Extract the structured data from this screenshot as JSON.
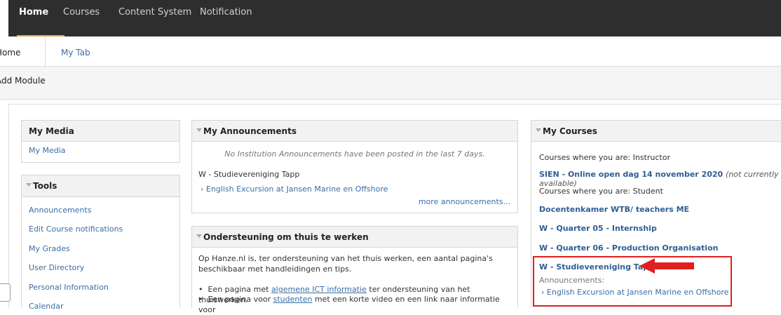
{
  "topnav": [
    {
      "label": "Home",
      "active": true
    },
    {
      "label": "Courses",
      "active": false
    },
    {
      "label": "Content System",
      "active": false
    },
    {
      "label": "Notification",
      "active": false
    }
  ],
  "tabs": {
    "home": "Home",
    "my_tab": "My Tab"
  },
  "add_module": "Add Module",
  "my_media": {
    "title": "My Media",
    "link": "My Media"
  },
  "tools": {
    "title": "Tools",
    "items": [
      "Announcements",
      "Edit Course notifications",
      "My Grades",
      "User Directory",
      "Personal Information",
      "Calendar"
    ]
  },
  "announcements": {
    "title": "My Announcements",
    "none_msg": "No Institution Announcements have been posted in the last 7 days.",
    "group": "W - Studievereniging Tapp",
    "item": "English Excursion at Jansen Marine en Offshore",
    "more": "more announcements..."
  },
  "support": {
    "title": "Ondersteuning om thuis te werken",
    "intro": "Op Hanze.nl is, ter ondersteuning van het thuis werken, een aantal pagina's beschikbaar met handleidingen en tips.",
    "b1_pre": "Een pagina met ",
    "b1_link": "algemene ICT informatie",
    "b1_post": " ter ondersteuning van het thuiswerken.",
    "b2_pre": "Een pagina voor ",
    "b2_link": "studenten",
    "b2_post": " met een korte video en een link naar informatie voor"
  },
  "courses": {
    "title": "My Courses",
    "instructor_label": "Courses where you are: Instructor",
    "instructor_course": "SIEN - Online open dag 14 november 2020",
    "instructor_note": "(not currently available)",
    "student_label": "Courses where you are: Student",
    "student_courses": [
      "Docentenkamer WTB/ teachers ME",
      "W - Quarter 05 - Internship",
      "W - Quarter 06 - Production Organisation",
      "W - Studievereniging Tapp"
    ],
    "ann_label": "Announcements:",
    "ann_item": "English Excursion at Jansen Marine en Offshore"
  },
  "colors": {
    "highlight": "#e02020",
    "accent": "#e8a33c",
    "link": "#3a6ea5"
  }
}
